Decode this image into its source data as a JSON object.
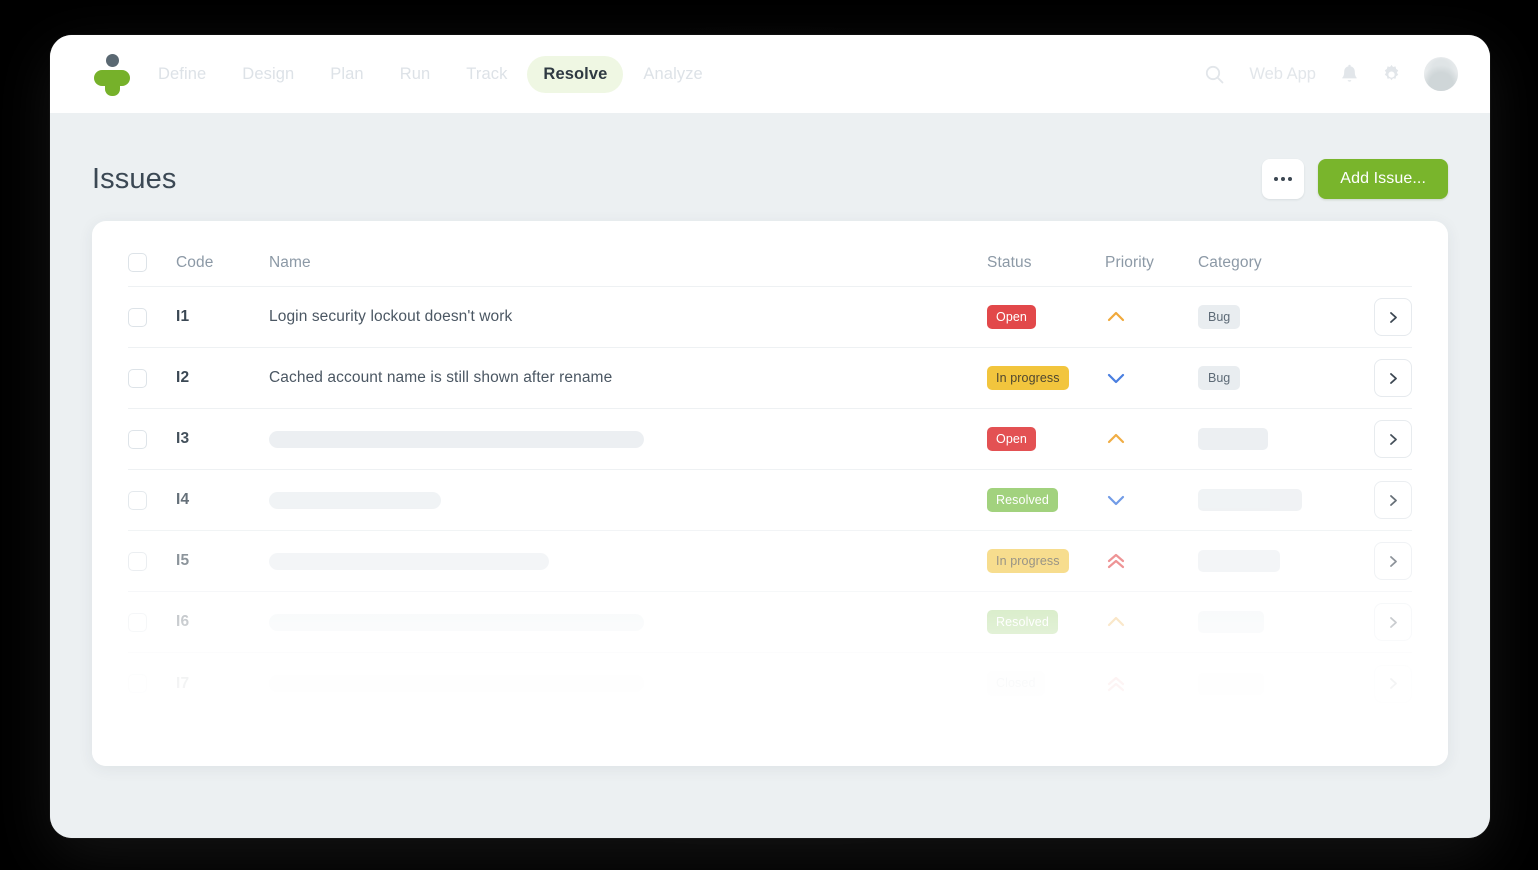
{
  "header": {
    "logo_name": "product-logo",
    "nav": [
      {
        "label": "Define",
        "active": false
      },
      {
        "label": "Design",
        "active": false
      },
      {
        "label": "Plan",
        "active": false
      },
      {
        "label": "Run",
        "active": false
      },
      {
        "label": "Track",
        "active": false
      },
      {
        "label": "Resolve",
        "active": true
      },
      {
        "label": "Analyze",
        "active": false
      }
    ],
    "workspace_label": "Web App",
    "icons": [
      "search-icon",
      "bell-icon",
      "gear-icon",
      "avatar"
    ]
  },
  "page": {
    "title": "Issues",
    "more_button_label": "...",
    "add_button_label": "Add Issue..."
  },
  "table": {
    "columns": {
      "check": "",
      "code": "Code",
      "name": "Name",
      "status": "Status",
      "priority": "Priority",
      "category": "Category"
    },
    "rows": [
      {
        "code": "I1",
        "name": "Login security lockout doesn't work",
        "name_skeleton": 0,
        "status": "Open",
        "status_kind": "open",
        "priority": "up",
        "priority_color": "#f0a93b",
        "category": "Bug",
        "category_skeleton": 0
      },
      {
        "code": "I2",
        "name": "Cached account name is still shown after rename",
        "name_skeleton": 0,
        "status": "In progress",
        "status_kind": "progress",
        "priority": "down",
        "priority_color": "#4a7fe0",
        "category": "Bug",
        "category_skeleton": 0
      },
      {
        "code": "I3",
        "name": "",
        "name_skeleton": 375,
        "status": "Open",
        "status_kind": "open",
        "priority": "up",
        "priority_color": "#f0a93b",
        "category": "",
        "category_skeleton": 70
      },
      {
        "code": "I4",
        "name": "",
        "name_skeleton": 172,
        "status": "Resolved",
        "status_kind": "resolved",
        "priority": "down",
        "priority_color": "#4a7fe0",
        "category": "",
        "category_skeleton": 104
      },
      {
        "code": "I5",
        "name": "",
        "name_skeleton": 280,
        "status": "In progress",
        "status_kind": "progress",
        "priority": "double-up",
        "priority_color": "#e2484a",
        "category": "",
        "category_skeleton": 82
      },
      {
        "code": "I6",
        "name": "",
        "name_skeleton": 375,
        "status": "Resolved",
        "status_kind": "resolved",
        "priority": "up",
        "priority_color": "#f0a93b",
        "category": "",
        "category_skeleton": 66
      },
      {
        "code": "I7",
        "name": "",
        "name_skeleton": 375,
        "status": "Closed",
        "status_kind": "closed",
        "priority": "double-up",
        "priority_color": "#e2484a",
        "category": "",
        "category_skeleton": 66
      }
    ],
    "row_action_icon": "chevron-right-icon"
  },
  "colors": {
    "brand_green": "#79b52c",
    "active_pill": "#eff7e3",
    "page_bg": "#ecf0f2",
    "status_open": "#e2484a",
    "status_progress": "#f2c53d",
    "status_resolved": "#88c65a",
    "status_closed": "#f4f6f8"
  }
}
